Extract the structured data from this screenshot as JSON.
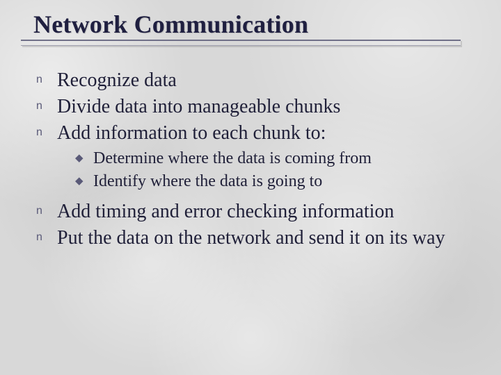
{
  "title": "Network Communication",
  "bullets_top": [
    "Recognize data",
    "Divide data into manageable chunks",
    "Add information to each chunk to:"
  ],
  "sub_bullets": [
    "Determine where the data is coming from",
    "Identify where the data is going to"
  ],
  "bullets_bottom": [
    "Add timing and error checking information",
    "Put the data on the network and send it on its way"
  ],
  "glyphs": {
    "level1": "n",
    "level2": "◆"
  }
}
